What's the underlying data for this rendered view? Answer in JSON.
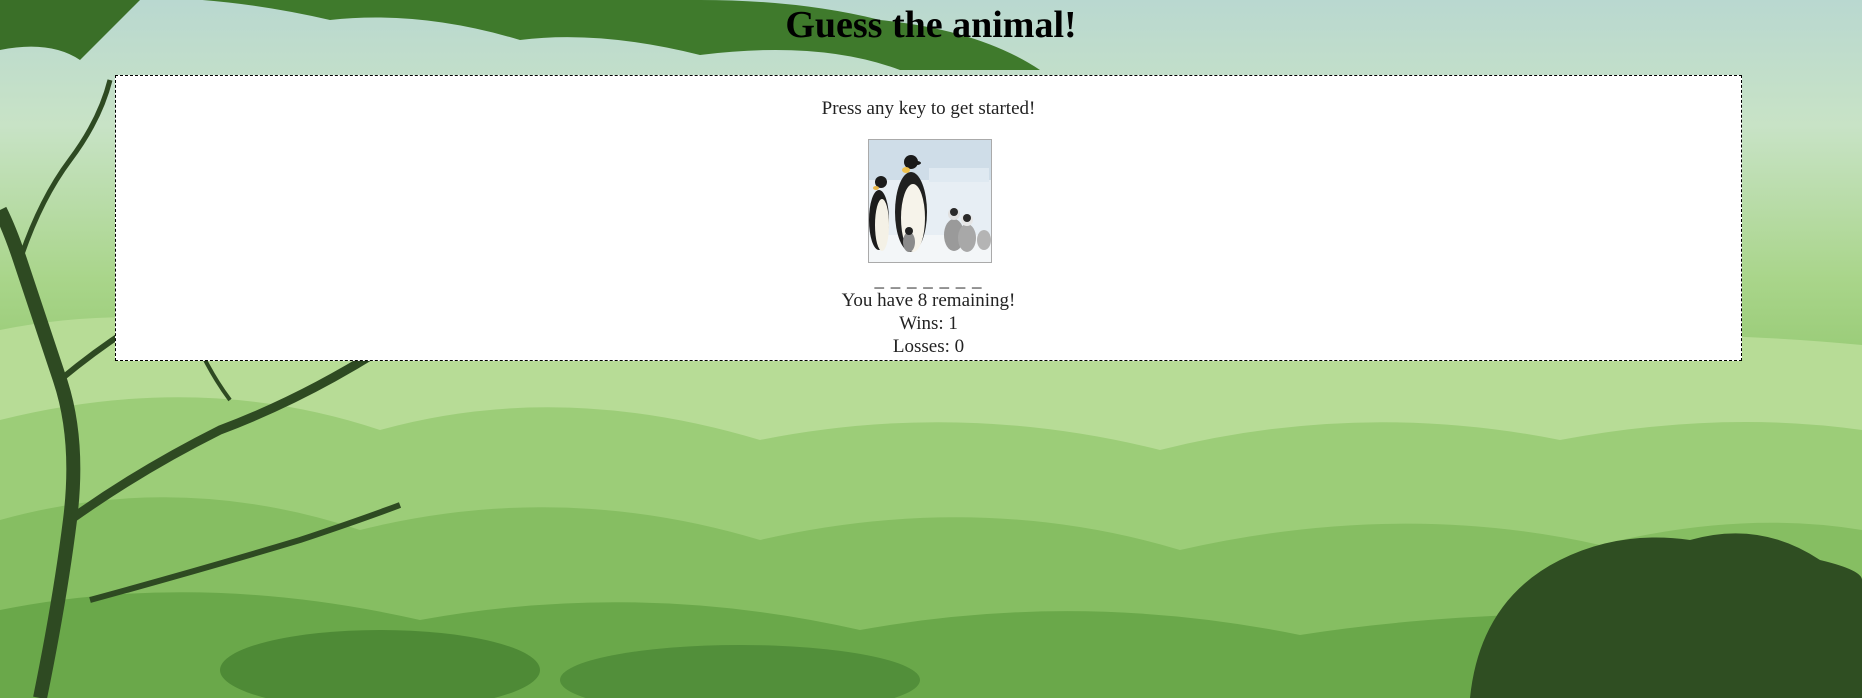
{
  "page": {
    "title": "Guess the animal!"
  },
  "game": {
    "prompt": "Press any key to get started!",
    "image_subject": "penguins",
    "word_blanks": "_ _ _ _ _ _ _",
    "remaining_text": "You have 8 remaining!",
    "wins_text": "Wins: 1",
    "losses_text": "Losses: 0"
  },
  "colors": {
    "panel_bg": "#ffffff",
    "panel_border": "#000000",
    "jungle_light": "#a9d58a",
    "jungle_dark": "#3f6f2c"
  }
}
